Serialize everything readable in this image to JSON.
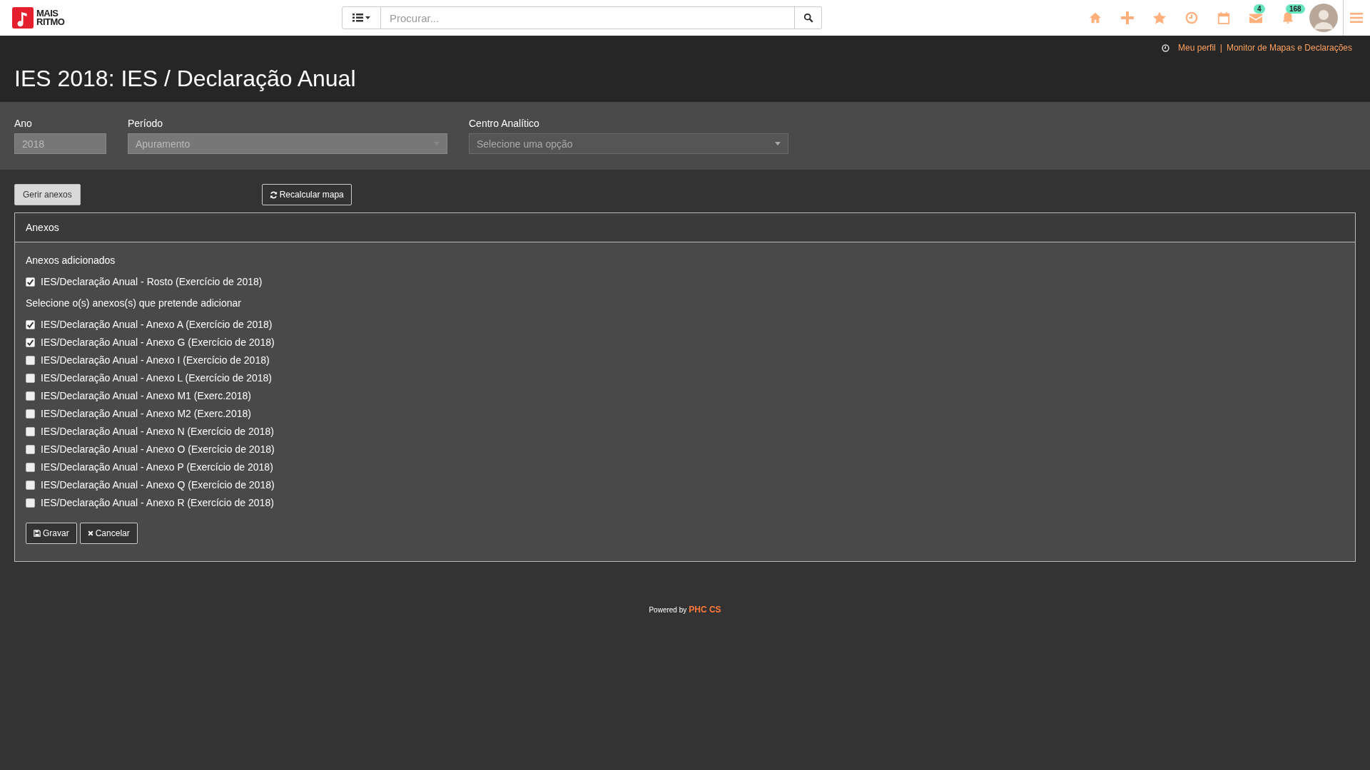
{
  "header": {
    "logo": {
      "line_1": "MAIS",
      "line_2": "RITMO"
    },
    "search": {
      "placeholder": "Procurar..."
    },
    "badges": {
      "mail": "4",
      "notifications": "168"
    }
  },
  "links": [
    "Meu perfil",
    "Monitor de Mapas e Declarações"
  ],
  "link_separator": "|",
  "title": "IES 2018: IES / Declaração Anual",
  "filters": [
    {
      "label": "Ano",
      "value": "2018",
      "kind": "input"
    },
    {
      "label": "Período",
      "value": "Apuramento",
      "kind": "select"
    },
    {
      "label": "Centro Analítico",
      "placeholder": "Selecione uma opção",
      "kind": "select"
    }
  ],
  "actions": {
    "manage": "Gerir anexos",
    "recalculate": "Recalcular mapa"
  },
  "panel": {
    "title": "Anexos",
    "added_heading": "Anexos adicionados",
    "added": [
      {
        "label": "IES/Declaração Anual - Rosto (Exercício de 2018)",
        "checked": true
      }
    ],
    "select_heading": "Selecione o(s) anexos(s) que pretende adicionar",
    "options": [
      {
        "label": "IES/Declaração Anual - Anexo A (Exercício de 2018)",
        "checked": true
      },
      {
        "label": "IES/Declaração Anual - Anexo G (Exercício de 2018)",
        "checked": true
      },
      {
        "label": "IES/Declaração Anual - Anexo I (Exercício de 2018)",
        "checked": false
      },
      {
        "label": "IES/Declaração Anual - Anexo L (Exercício de 2018)",
        "checked": false
      },
      {
        "label": "IES/Declaração Anual - Anexo M1 (Exerc.2018)",
        "checked": false
      },
      {
        "label": "IES/Declaração Anual - Anexo M2 (Exerc.2018)",
        "checked": false
      },
      {
        "label": "IES/Declaração Anual - Anexo N (Exercício de 2018)",
        "checked": false
      },
      {
        "label": "IES/Declaração Anual - Anexo O (Exercício de 2018)",
        "checked": false
      },
      {
        "label": "IES/Declaração Anual - Anexo P (Exercício de 2018)",
        "checked": false
      },
      {
        "label": "IES/Declaração Anual - Anexo Q (Exercício de 2018)",
        "checked": false
      },
      {
        "label": "IES/Declaração Anual - Anexo R (Exercício de 2018)",
        "checked": false
      }
    ],
    "buttons": {
      "save": "Gravar",
      "cancel": "Cancelar"
    }
  },
  "footer": {
    "prefix": "Powered by",
    "brand": "PHC CS"
  }
}
